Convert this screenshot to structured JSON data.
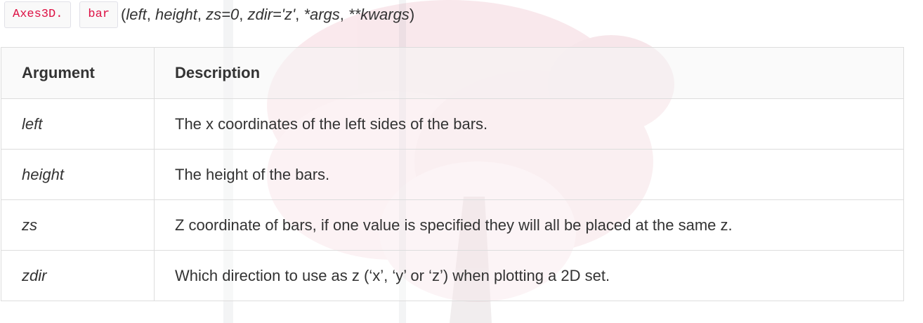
{
  "signature": {
    "class_chip": "Axes3D.",
    "method_chip": "bar",
    "open_paren": "(",
    "params": [
      {
        "text": "left",
        "sep": ", "
      },
      {
        "text": "height",
        "sep": ", "
      },
      {
        "text": "zs=0",
        "sep": ", "
      },
      {
        "text": "zdir='z'",
        "sep": ", "
      },
      {
        "text": "*args",
        "sep": ", "
      },
      {
        "text": "**kwargs",
        "sep": ""
      }
    ],
    "close_paren": ")"
  },
  "table": {
    "headers": [
      "Argument",
      "Description"
    ],
    "rows": [
      {
        "argument": "left",
        "description": "The x coordinates of the left sides of the bars."
      },
      {
        "argument": "height",
        "description": "The height of the bars."
      },
      {
        "argument": "zs",
        "description": "Z coordinate of bars, if one value is specified they will all be placed at the same z."
      },
      {
        "argument": "zdir",
        "description": "Which direction to use as z (‘x’, ‘y’ or ‘z’) when plotting a 2D set."
      }
    ]
  },
  "colors": {
    "code_text": "#dd1144",
    "border": "#dddddd",
    "text": "#333333",
    "background_art": "#e8a3b0"
  }
}
